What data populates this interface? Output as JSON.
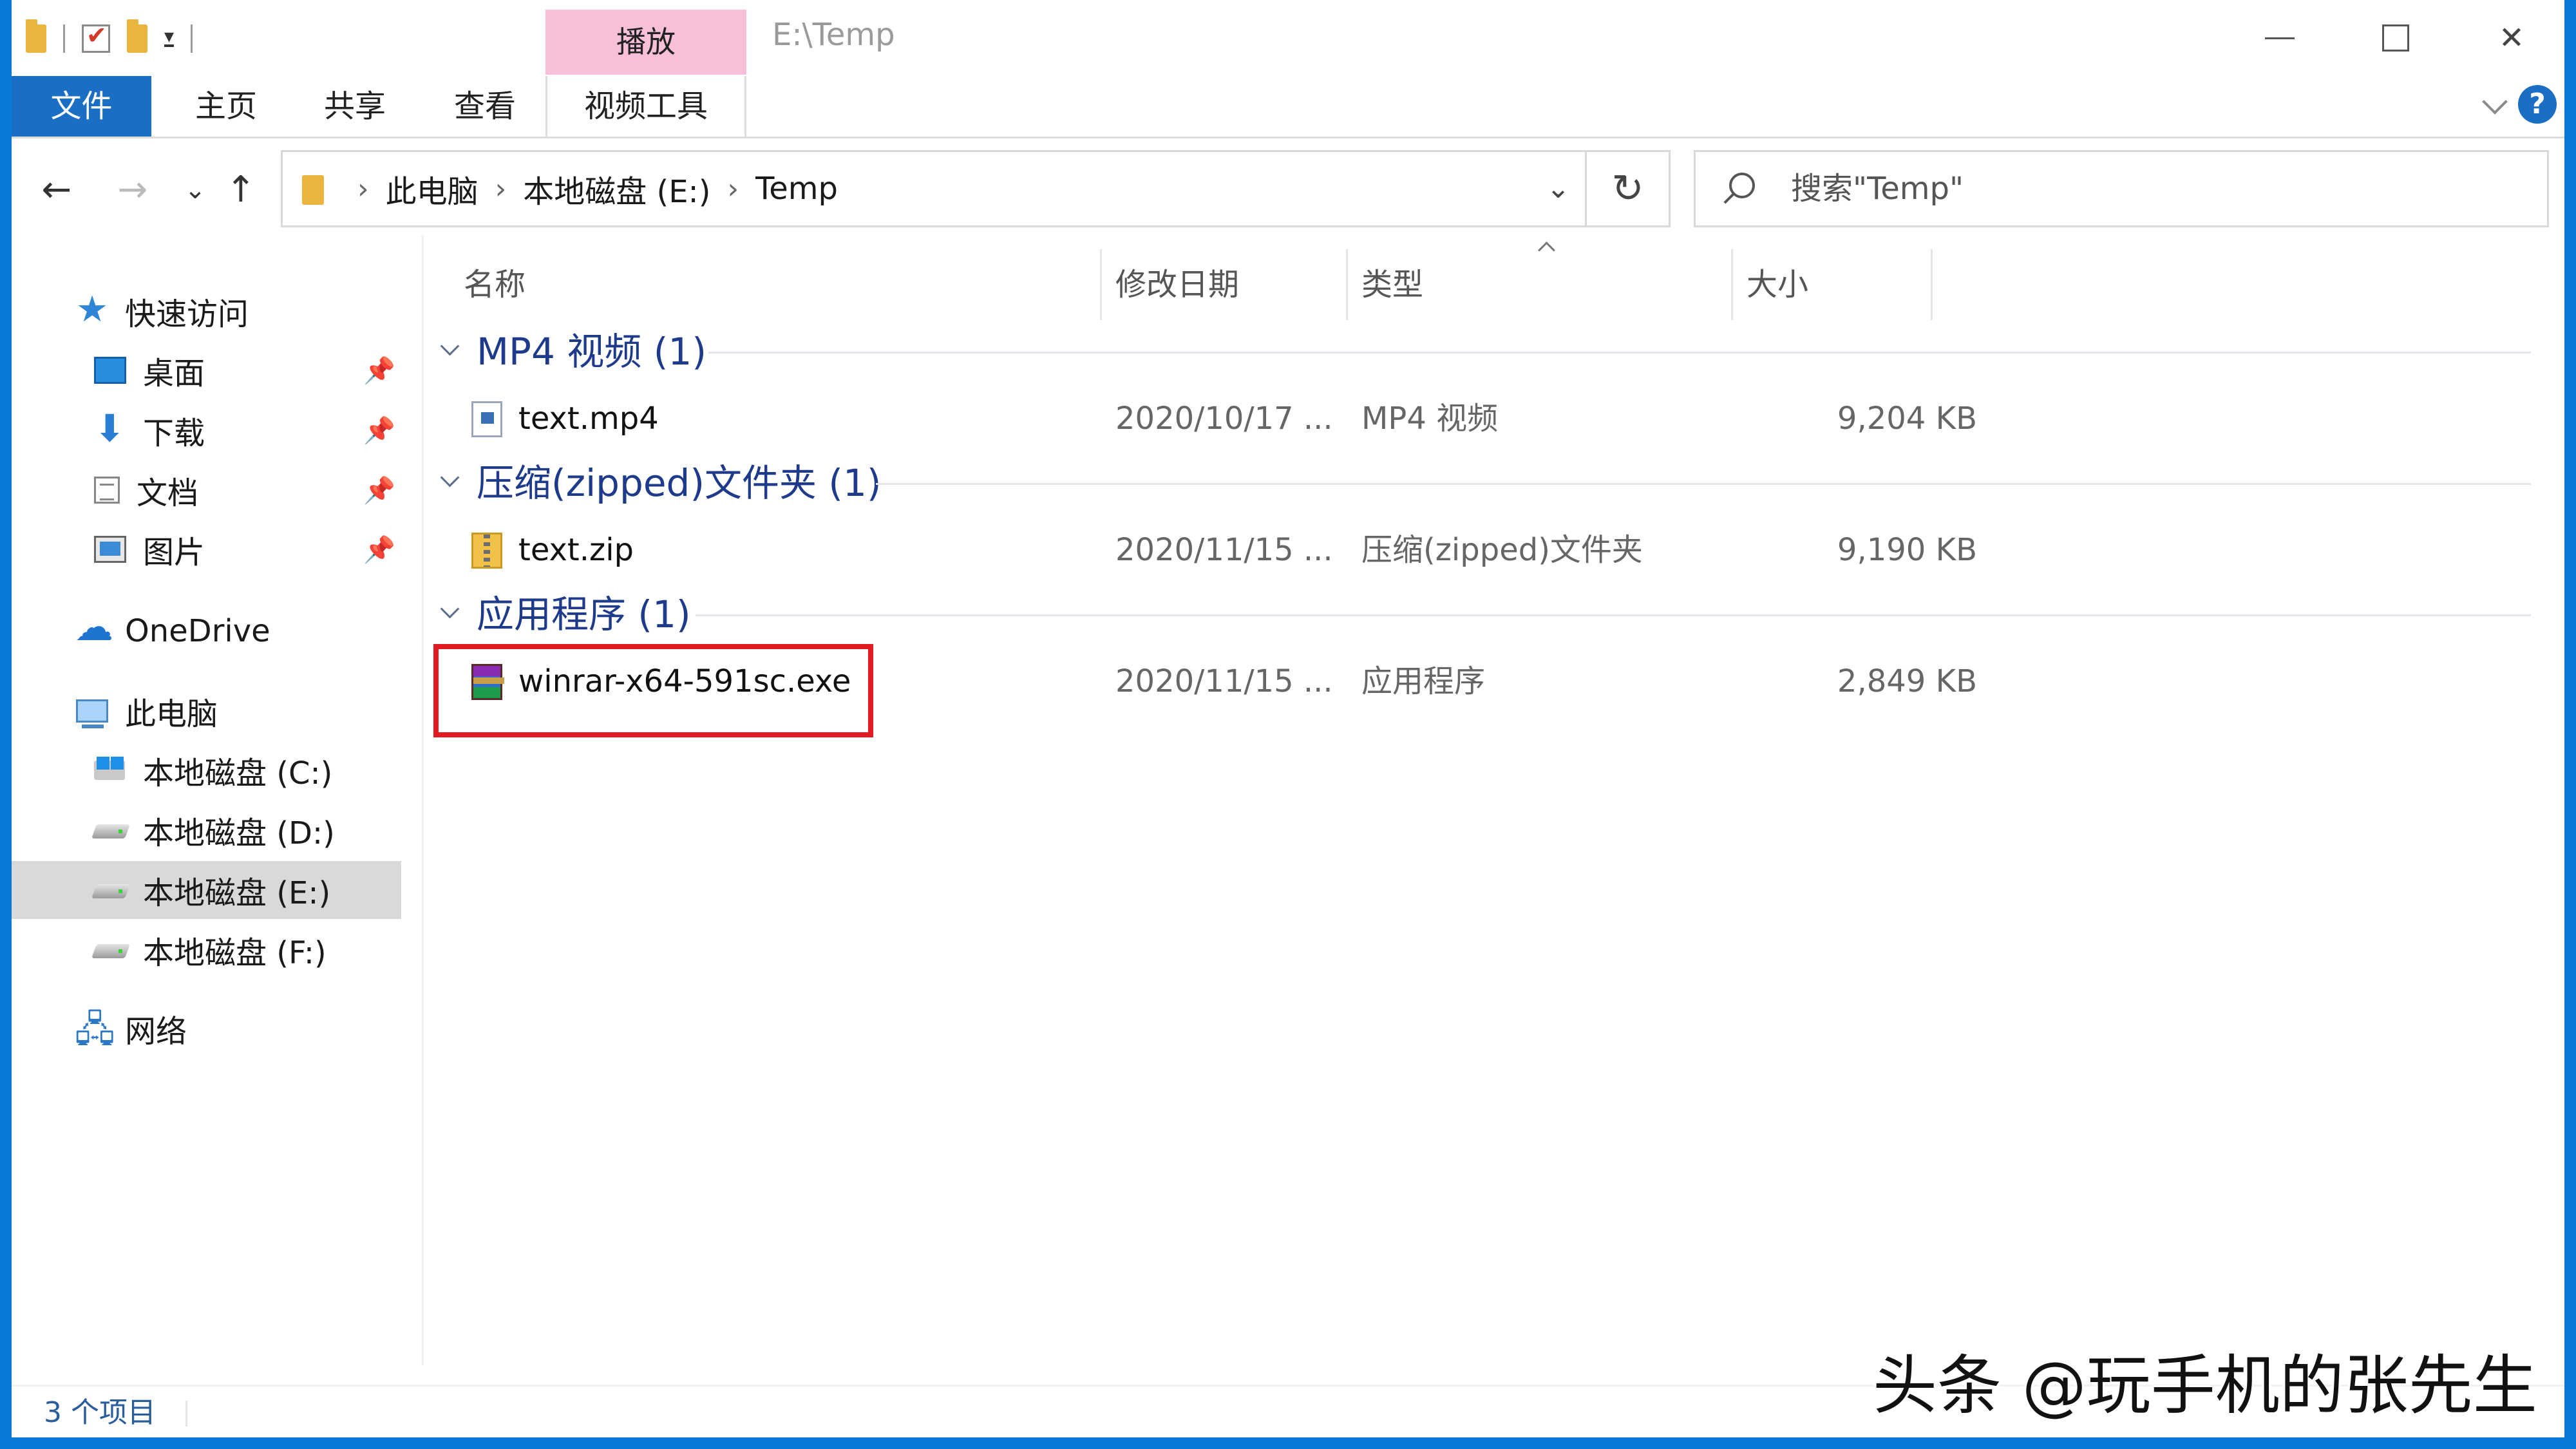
{
  "titlebar": {
    "context_tab_header": "播放",
    "title": "E:\\Temp"
  },
  "ribbon": {
    "tabs": [
      "文件",
      "主页",
      "共享",
      "查看",
      "视频工具"
    ],
    "help": "?"
  },
  "address": {
    "crumbs": [
      "此电脑",
      "本地磁盘 (E:)",
      "Temp"
    ],
    "search_placeholder": "搜索\"Temp\""
  },
  "nav": {
    "quick_access": "快速访问",
    "pinned": [
      "桌面",
      "下载",
      "文档",
      "图片"
    ],
    "onedrive": "OneDrive",
    "this_pc": "此电脑",
    "drives": [
      "本地磁盘 (C:)",
      "本地磁盘 (D:)",
      "本地磁盘 (E:)",
      "本地磁盘 (F:)"
    ],
    "selected_drive": "本地磁盘 (E:)",
    "network": "网络"
  },
  "columns": [
    "名称",
    "修改日期",
    "类型",
    "大小"
  ],
  "groups": [
    {
      "name": "MP4 视频 (1)",
      "file": {
        "name": "text.mp4",
        "date": "2020/10/17 ...",
        "type": "MP4 视频",
        "size": "9,204 KB",
        "icon": "video-file-icon"
      }
    },
    {
      "name": "压缩(zipped)文件夹 (1)",
      "file": {
        "name": "text.zip",
        "date": "2020/11/15 ...",
        "type": "压缩(zipped)文件夹",
        "size": "9,190 KB",
        "icon": "zip-folder-icon"
      }
    },
    {
      "name": "应用程序 (1)",
      "file": {
        "name": "winrar-x64-591sc.exe",
        "date": "2020/11/15 ...",
        "type": "应用程序",
        "size": "2,849 KB",
        "icon": "winrar-icon"
      }
    }
  ],
  "status": {
    "item_count": "3 个项目"
  },
  "watermark": "头条 @玩手机的张先生",
  "colors": {
    "accent": "#1a6fc4",
    "context_tab": "#f7c0d8",
    "group_header": "#1e3a8a",
    "highlight": "#e11b22"
  }
}
